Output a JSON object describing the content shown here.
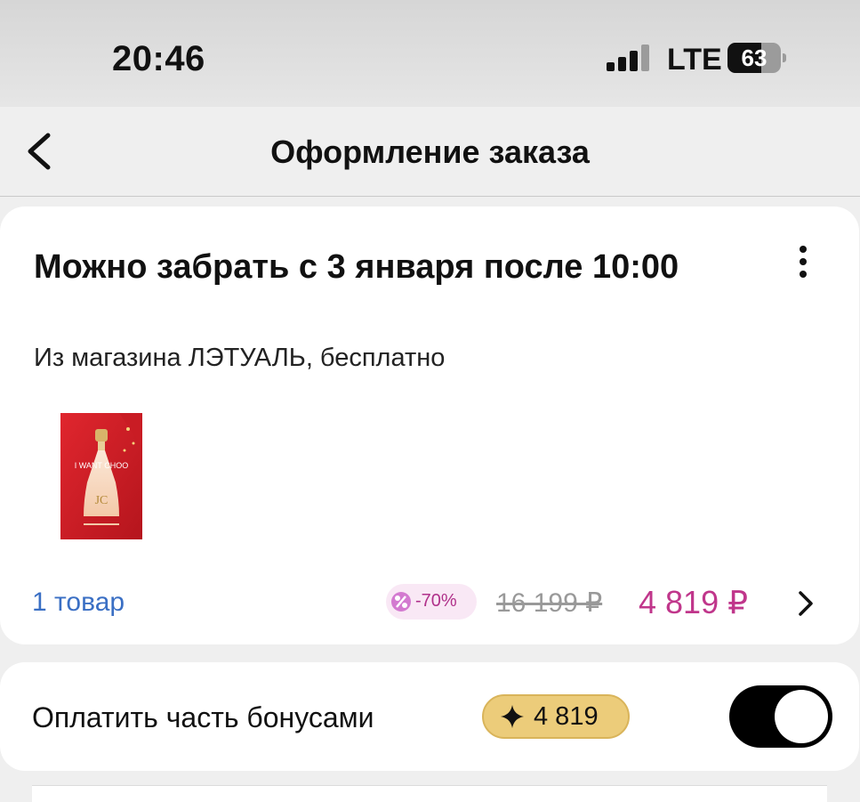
{
  "status_bar": {
    "time": "20:46",
    "network": "LTE",
    "battery": "63",
    "battery_level": 0.63,
    "signal_bars": 3,
    "signal_max": 4
  },
  "nav": {
    "title": "Оформление заказа",
    "back_icon": "chevron-left-icon"
  },
  "order": {
    "pickup_title": "Можно забрать с 3 января после 10:00",
    "pickup_subtitle": "Из магазина ЛЭТУАЛЬ, бесплатно",
    "more_icon": "more-vertical-icon",
    "product_image": "perfume-bottle-image",
    "items_link": "1 товар",
    "discount": "-70%",
    "old_price": "16 199 ₽",
    "new_price": "4 819 ₽",
    "chevron_icon": "chevron-right-icon"
  },
  "bonus": {
    "label": "Оплатить часть бонусами",
    "amount": "4 819",
    "star_icon": "star-sparkle-icon",
    "toggle_on": true
  },
  "colors": {
    "link": "#3a6fc4",
    "price_accent": "#c0368b",
    "bonus_badge": "#eccc7a",
    "background": "#efefef"
  }
}
